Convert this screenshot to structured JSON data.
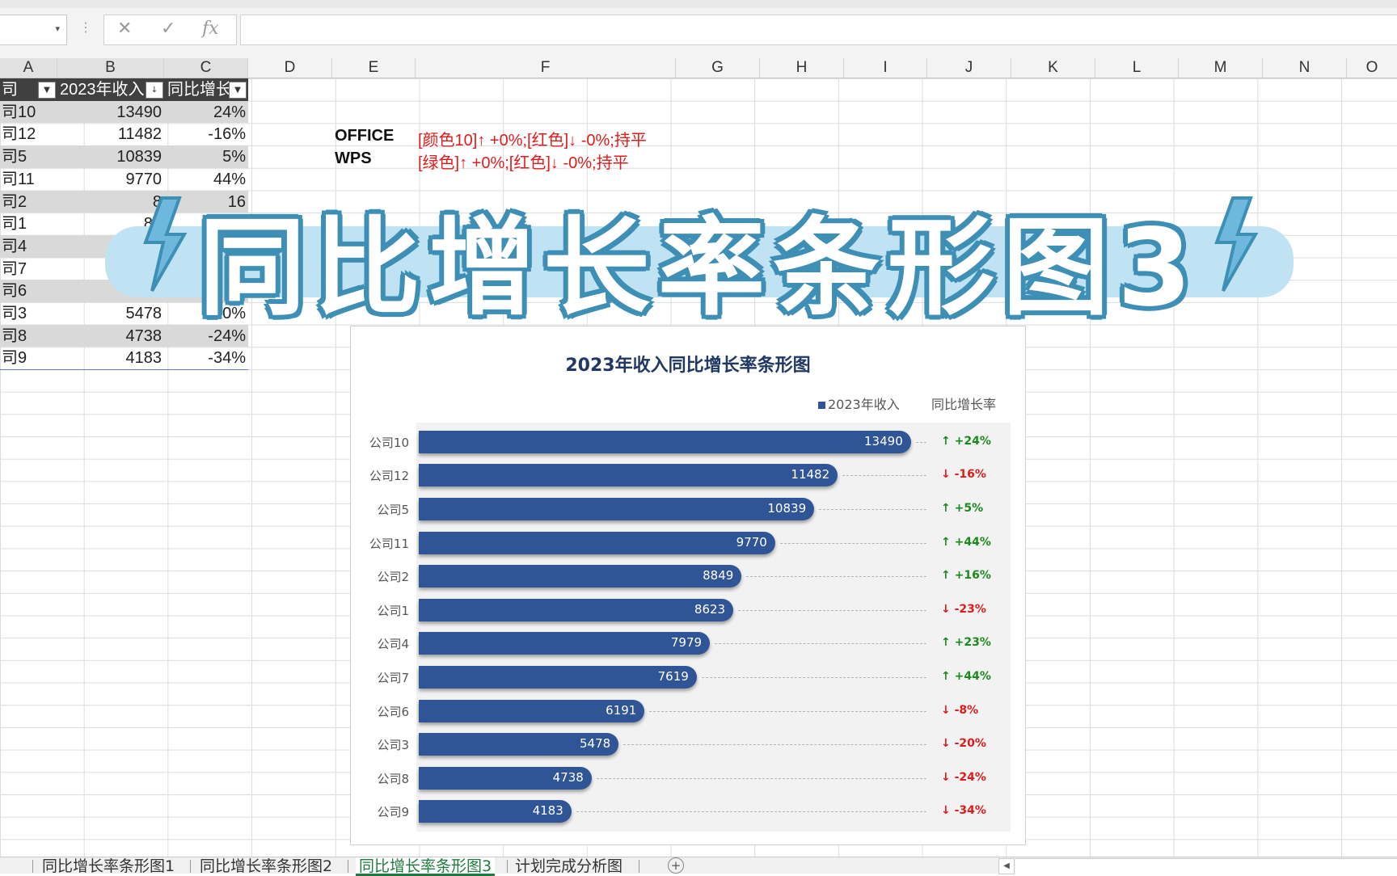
{
  "formula_bar": {
    "name_box": "",
    "cancel_icon": "✕",
    "enter_icon": "✓",
    "fx_label": "fx",
    "formula": ""
  },
  "columns": [
    "A",
    "B",
    "C",
    "D",
    "E",
    "F",
    "G",
    "H",
    "I",
    "J",
    "K",
    "L",
    "M",
    "N",
    "O"
  ],
  "table": {
    "headers": [
      "司",
      "2023年收入",
      "同比增长"
    ],
    "rows": [
      {
        "name": "司10",
        "revenue": "13490",
        "growth": "24%"
      },
      {
        "name": "司12",
        "revenue": "11482",
        "growth": "-16%"
      },
      {
        "name": "司5",
        "revenue": "10839",
        "growth": "5%"
      },
      {
        "name": "司11",
        "revenue": "9770",
        "growth": "44%"
      },
      {
        "name": "司2",
        "revenue": "8",
        "growth": "16"
      },
      {
        "name": "司1",
        "revenue": "86",
        "growth": ""
      },
      {
        "name": "司4",
        "revenue": "7",
        "growth": ""
      },
      {
        "name": "司7",
        "revenue": "",
        "growth": ""
      },
      {
        "name": "司6",
        "revenue": "",
        "growth": ""
      },
      {
        "name": "司3",
        "revenue": "5478",
        "growth": "-20%"
      },
      {
        "name": "司8",
        "revenue": "4738",
        "growth": "-24%"
      },
      {
        "name": "司9",
        "revenue": "4183",
        "growth": "-34%"
      }
    ]
  },
  "notes": [
    {
      "key": "OFFICE",
      "value": "[颜色10]↑ +0%;[红色]↓ -0%;持平"
    },
    {
      "key": "WPS",
      "value": "[绿色]↑ +0%;[红色]↓ -0%;持平"
    }
  ],
  "banner": {
    "text": "同比增长率条形图3"
  },
  "chart_data": {
    "type": "bar",
    "orientation": "horizontal",
    "title": "2023年收入同比增长率条形图",
    "legend": [
      "2023年收入",
      "同比增长率"
    ],
    "legend_position": "top-right",
    "categories": [
      "公司10",
      "公司12",
      "公司5",
      "公司11",
      "公司2",
      "公司1",
      "公司4",
      "公司7",
      "公司6",
      "公司3",
      "公司8",
      "公司9"
    ],
    "series": [
      {
        "name": "2023年收入",
        "values": [
          13490,
          11482,
          10839,
          9770,
          8849,
          8623,
          7979,
          7619,
          6191,
          5478,
          4738,
          4183
        ],
        "color": "#2f5597"
      }
    ],
    "growth_labels": [
      "+24%",
      "-16%",
      "+5%",
      "+44%",
      "+16%",
      "-23%",
      "+23%",
      "+44%",
      "-8%",
      "-20%",
      "-24%",
      "-34%"
    ],
    "up_color": "#1a8b1a",
    "down_color": "#e01b1b",
    "xlim": [
      0,
      16000
    ]
  },
  "sheet_tabs": [
    "同比增长率条形图1",
    "同比增长率条形图2",
    "同比增长率条形图3",
    "计划完成分析图"
  ],
  "active_tab": 2
}
